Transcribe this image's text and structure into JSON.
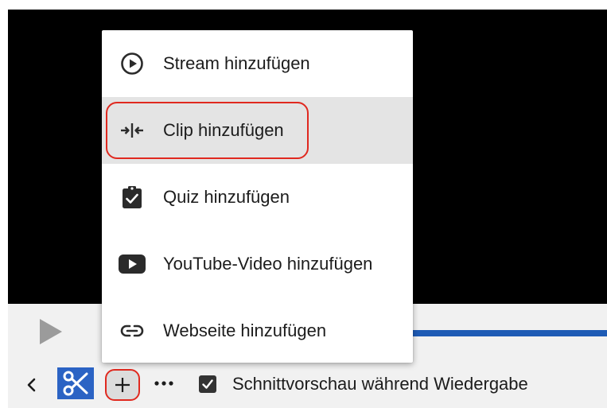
{
  "menu": {
    "items": [
      {
        "label": "Stream hinzufügen",
        "icon": "play-circle-icon",
        "active": false
      },
      {
        "label": "Clip hinzufügen",
        "icon": "clip-merge-icon",
        "active": true
      },
      {
        "label": "Quiz hinzufügen",
        "icon": "clipboard-check-icon",
        "active": false
      },
      {
        "label": "YouTube-Video hinzufügen",
        "icon": "youtube-icon",
        "active": false
      },
      {
        "label": "Webseite hinzufügen",
        "icon": "link-icon",
        "active": false
      }
    ]
  },
  "player": {
    "play_icon": "play-icon"
  },
  "toolbar": {
    "back_icon": "chevron-left-icon",
    "cut_icon": "scissors-icon",
    "add_icon": "plus-icon",
    "more_icon": "more-horizontal-icon",
    "preview_checkbox_checked": true,
    "preview_checkbox_label": "Schnittvorschau während Wiedergabe"
  },
  "colors": {
    "accent_blue": "#2b63c4",
    "progress_blue": "#1e5bb5",
    "highlight_red": "#e0291f",
    "video_bg": "#000000"
  }
}
